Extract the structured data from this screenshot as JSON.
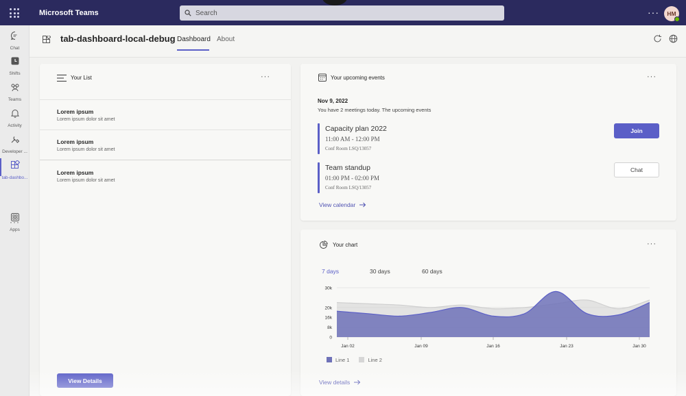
{
  "app": {
    "name": "Microsoft Teams",
    "avatar_initials": "HM"
  },
  "search": {
    "placeholder": "Search"
  },
  "topbar": {
    "more_label": "···"
  },
  "rail": {
    "items": [
      {
        "label": "Chat",
        "icon": "chat-icon"
      },
      {
        "label": "Shifts",
        "icon": "shifts-icon"
      },
      {
        "label": "Teams",
        "icon": "teams-icon"
      },
      {
        "label": "Activity",
        "icon": "bell-icon"
      },
      {
        "label": "Developer ...",
        "icon": "developer-icon"
      },
      {
        "label": "tab-dashbo...",
        "icon": "app-grid-icon"
      },
      {
        "label": "Apps",
        "icon": "apps-icon"
      }
    ],
    "more_label": "···"
  },
  "header": {
    "title": "tab-dashboard-local-debug",
    "tabs": [
      {
        "label": "Dashboard"
      },
      {
        "label": "About"
      }
    ]
  },
  "list_card": {
    "title": "Your List",
    "more_label": "···",
    "items": [
      {
        "title": "Lorem ipsum",
        "subtitle": "Lorem ipsum dolor sit amet"
      },
      {
        "title": "Lorem ipsum",
        "subtitle": "Lorem ipsum dolor sit amet"
      },
      {
        "title": "Lorem ipsum",
        "subtitle": "Lorem ipsum dolor sit amet"
      }
    ],
    "button_label": "View Details"
  },
  "events_card": {
    "title": "Your upcoming events",
    "more_label": "···",
    "date": "Nov 9, 2022",
    "summary": "You have 2 meetings today. The upcoming events",
    "events": [
      {
        "name": "Capacity plan 2022",
        "time": "11:00 AM - 12:00 PM",
        "location": "Conf Room LSQ/13057",
        "action": "Join"
      },
      {
        "name": "Team standup",
        "time": "01:00 PM - 02:00 PM",
        "location": "Conf Room LSQ/13057",
        "action": "Chat"
      }
    ],
    "link_label": "View calendar"
  },
  "chart_card": {
    "title": "Your chart",
    "more_label": "···",
    "ranges": [
      "7 days",
      "30 days",
      "60 days"
    ],
    "link_label": "View details"
  },
  "colors": {
    "accent": "#5b5fc7",
    "topbar": "#2b2a5e",
    "line1": "#6f72b8",
    "line2": "#d6d6d6"
  },
  "chart_data": {
    "type": "area",
    "x_ticks": [
      "Jan 02",
      "Jan 09",
      "Jan 16",
      "Jan 23",
      "Jan 30"
    ],
    "y_ticks": [
      "0",
      "8k",
      "16k",
      "20k",
      "30k"
    ],
    "x": [
      "Jan 01",
      "Jan 04",
      "Jan 07",
      "Jan 10",
      "Jan 13",
      "Jan 16",
      "Jan 19",
      "Jan 22",
      "Jan 25",
      "Jan 28",
      "Jan 31"
    ],
    "series": [
      {
        "name": "Line 1",
        "values": [
          21000,
          19000,
          17000,
          20000,
          24000,
          17000,
          19000,
          37000,
          19000,
          18000,
          28000
        ]
      },
      {
        "name": "Line 2",
        "values": [
          28000,
          27000,
          26000,
          24000,
          26000,
          23000,
          24000,
          27000,
          30000,
          23000,
          30000
        ]
      }
    ],
    "legend_position": "bottom-left",
    "grid": true
  }
}
